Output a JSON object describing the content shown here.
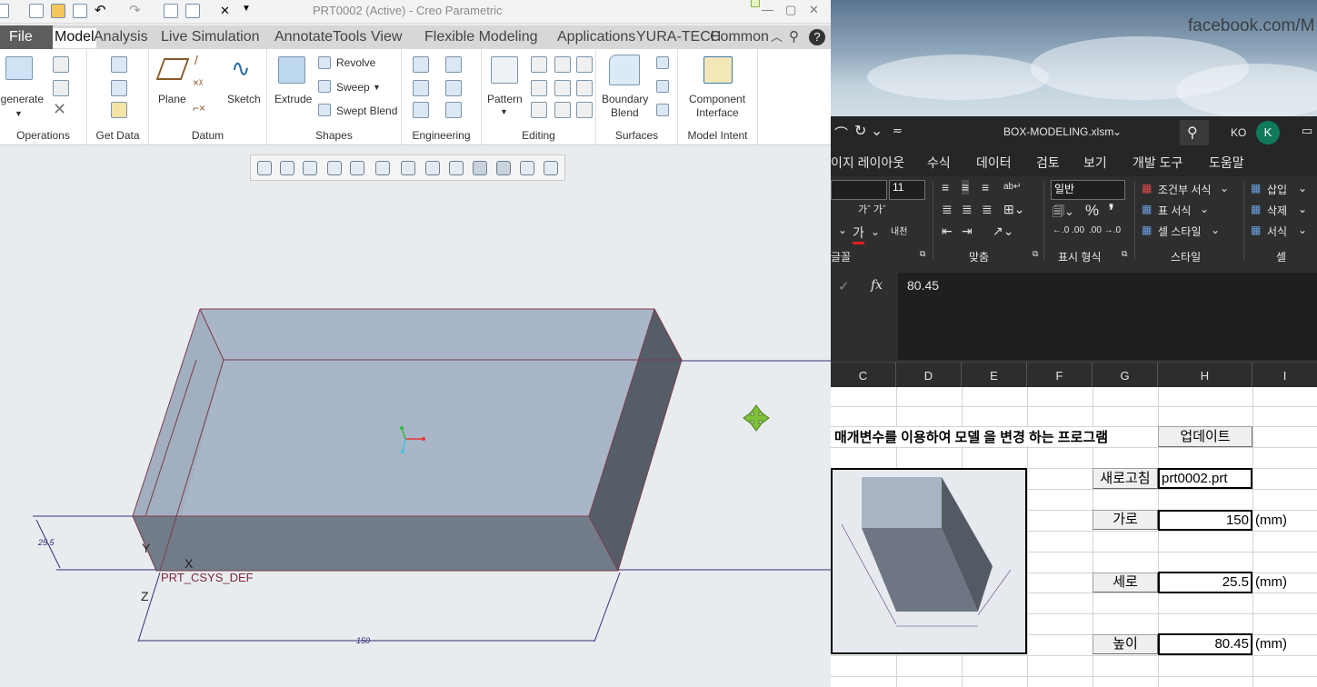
{
  "creo": {
    "title": "PRT0002 (Active) - Creo Parametric",
    "menu": [
      {
        "label": "File"
      },
      {
        "label": "Model"
      },
      {
        "label": "Analysis"
      },
      {
        "label": "Live Simulation"
      },
      {
        "label": "Annotate"
      },
      {
        "label": "Tools"
      },
      {
        "label": "View"
      },
      {
        "label": "Flexible Modeling"
      },
      {
        "label": "Applications"
      },
      {
        "label": "YURA-TECH"
      },
      {
        "label": "Common"
      }
    ],
    "ribbon": {
      "regenerate": "egenerate",
      "plane": "Plane",
      "sketch": "Sketch",
      "extrude": "Extrude",
      "revolve": "Revolve",
      "sweep": "Sweep",
      "swept_blend": "Swept Blend",
      "pattern": "Pattern",
      "boundary_blend": [
        "Boundary",
        "Blend"
      ],
      "component_interface": [
        "Component",
        "Interface"
      ]
    },
    "groups": [
      "Operations",
      "Get Data",
      "Datum",
      "Shapes",
      "Engineering",
      "Editing",
      "Surfaces",
      "Model Intent"
    ],
    "viewport": {
      "dim_height": "25.5",
      "dim_width": "150",
      "axis_y": "Y",
      "axis_x": "X",
      "axis_z": "Z",
      "csys": "PRT_CSYS_DEF"
    }
  },
  "background_text": "facebook.com/M",
  "excel": {
    "filename": "BOX-MODELING.xlsm",
    "user_initials": "KO",
    "avatar_letter": "K",
    "tabs": [
      "이지 레이아웃",
      "수식",
      "데이터",
      "검토",
      "보기",
      "개발 도구",
      "도움말"
    ],
    "font_size": "11",
    "number_format": "일반",
    "style_items": [
      "조건부 서식",
      "표 서식",
      "셀 스타일"
    ],
    "cell_items": [
      "삽입",
      "삭제",
      "서식"
    ],
    "group_labels": [
      "글꼴",
      "맞춤",
      "표시 형식",
      "스타일",
      "셀"
    ],
    "fx": "fx",
    "formula_value": "80.45",
    "columns": [
      "C",
      "D",
      "E",
      "F",
      "G",
      "H",
      "I"
    ],
    "sheet": {
      "heading": "매개변수를 이용하여 모델 을 변경 하는 프로그램",
      "update_button": "업데이트",
      "refresh_button": "새로고침",
      "filename_value": "prt0002.prt",
      "width_label": "가로",
      "width_value": "150",
      "depth_label": "세로",
      "depth_value": "25.5",
      "height_label": "높이",
      "height_value": "80.45",
      "unit": "(mm)"
    }
  },
  "colors": {
    "creo_bg": "#e9ecef",
    "box_top": "#a8b5c6",
    "box_front": "#727b88",
    "box_side": "#555d68",
    "excel_dark": "#262626"
  }
}
